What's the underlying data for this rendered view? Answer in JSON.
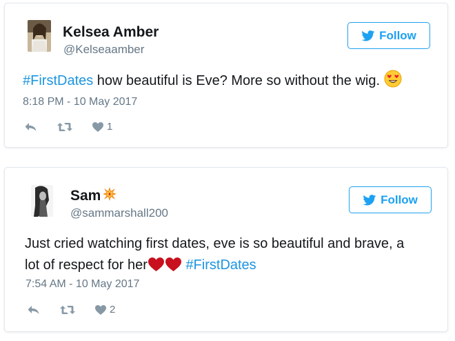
{
  "tweets": [
    {
      "name": "Kelsea Amber",
      "handle": "@Kelseaamber",
      "follow_label": "Follow",
      "text_hashtag": "#FirstDates",
      "text_body": " how beautiful is Eve? More so without the wig. ",
      "text_emoji": "smiling-face-with-heart-eyes-emoji",
      "timestamp": "8:18 PM - 10 May 2017",
      "like_count": "1"
    },
    {
      "name": "Sam",
      "name_emoji": "collision-emoji",
      "handle": "@sammarshall200",
      "follow_label": "Follow",
      "text_line1": "Just cried watching first dates, eve is so beautiful and brave, a",
      "text_line2_start": "lot of respect for her",
      "text_emoji": "red-heart-emoji",
      "text_hashtag": "#FirstDates",
      "timestamp": "7:54 AM - 10 May 2017",
      "like_count": "2"
    }
  ],
  "icons": {
    "reply": "reply-icon",
    "retweet": "retweet-icon",
    "like": "heart-icon",
    "follow_bird": "twitter-bird-icon"
  },
  "colors": {
    "accent": "#1da1f2",
    "hashtag": "#1b95e0",
    "muted": "#657786",
    "text": "#14171a",
    "border": "#e1e8ed"
  }
}
